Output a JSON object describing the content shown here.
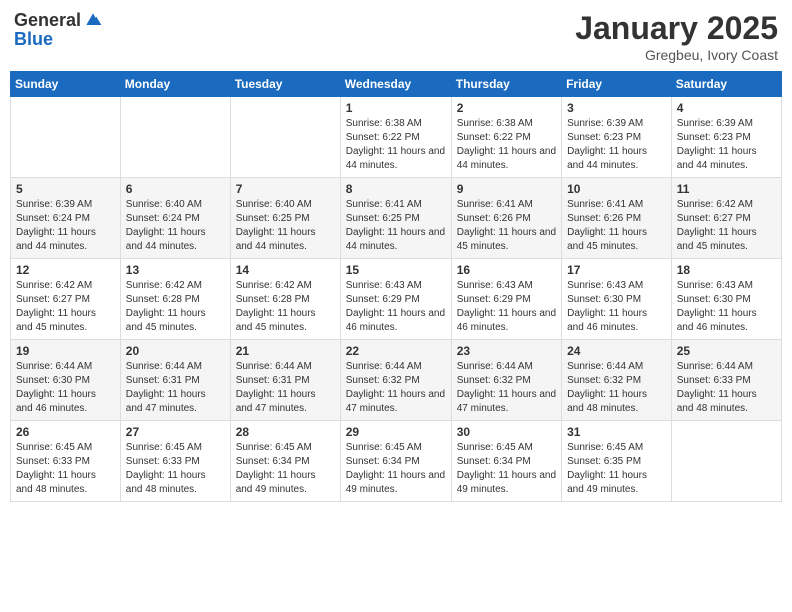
{
  "header": {
    "logo_general": "General",
    "logo_blue": "Blue",
    "title": "January 2025",
    "location": "Gregbeu, Ivory Coast"
  },
  "days_of_week": [
    "Sunday",
    "Monday",
    "Tuesday",
    "Wednesday",
    "Thursday",
    "Friday",
    "Saturday"
  ],
  "weeks": [
    [
      {
        "day": "",
        "info": ""
      },
      {
        "day": "",
        "info": ""
      },
      {
        "day": "",
        "info": ""
      },
      {
        "day": "1",
        "info": "Sunrise: 6:38 AM\nSunset: 6:22 PM\nDaylight: 11 hours and 44 minutes."
      },
      {
        "day": "2",
        "info": "Sunrise: 6:38 AM\nSunset: 6:22 PM\nDaylight: 11 hours and 44 minutes."
      },
      {
        "day": "3",
        "info": "Sunrise: 6:39 AM\nSunset: 6:23 PM\nDaylight: 11 hours and 44 minutes."
      },
      {
        "day": "4",
        "info": "Sunrise: 6:39 AM\nSunset: 6:23 PM\nDaylight: 11 hours and 44 minutes."
      }
    ],
    [
      {
        "day": "5",
        "info": "Sunrise: 6:39 AM\nSunset: 6:24 PM\nDaylight: 11 hours and 44 minutes."
      },
      {
        "day": "6",
        "info": "Sunrise: 6:40 AM\nSunset: 6:24 PM\nDaylight: 11 hours and 44 minutes."
      },
      {
        "day": "7",
        "info": "Sunrise: 6:40 AM\nSunset: 6:25 PM\nDaylight: 11 hours and 44 minutes."
      },
      {
        "day": "8",
        "info": "Sunrise: 6:41 AM\nSunset: 6:25 PM\nDaylight: 11 hours and 44 minutes."
      },
      {
        "day": "9",
        "info": "Sunrise: 6:41 AM\nSunset: 6:26 PM\nDaylight: 11 hours and 45 minutes."
      },
      {
        "day": "10",
        "info": "Sunrise: 6:41 AM\nSunset: 6:26 PM\nDaylight: 11 hours and 45 minutes."
      },
      {
        "day": "11",
        "info": "Sunrise: 6:42 AM\nSunset: 6:27 PM\nDaylight: 11 hours and 45 minutes."
      }
    ],
    [
      {
        "day": "12",
        "info": "Sunrise: 6:42 AM\nSunset: 6:27 PM\nDaylight: 11 hours and 45 minutes."
      },
      {
        "day": "13",
        "info": "Sunrise: 6:42 AM\nSunset: 6:28 PM\nDaylight: 11 hours and 45 minutes."
      },
      {
        "day": "14",
        "info": "Sunrise: 6:42 AM\nSunset: 6:28 PM\nDaylight: 11 hours and 45 minutes."
      },
      {
        "day": "15",
        "info": "Sunrise: 6:43 AM\nSunset: 6:29 PM\nDaylight: 11 hours and 46 minutes."
      },
      {
        "day": "16",
        "info": "Sunrise: 6:43 AM\nSunset: 6:29 PM\nDaylight: 11 hours and 46 minutes."
      },
      {
        "day": "17",
        "info": "Sunrise: 6:43 AM\nSunset: 6:30 PM\nDaylight: 11 hours and 46 minutes."
      },
      {
        "day": "18",
        "info": "Sunrise: 6:43 AM\nSunset: 6:30 PM\nDaylight: 11 hours and 46 minutes."
      }
    ],
    [
      {
        "day": "19",
        "info": "Sunrise: 6:44 AM\nSunset: 6:30 PM\nDaylight: 11 hours and 46 minutes."
      },
      {
        "day": "20",
        "info": "Sunrise: 6:44 AM\nSunset: 6:31 PM\nDaylight: 11 hours and 47 minutes."
      },
      {
        "day": "21",
        "info": "Sunrise: 6:44 AM\nSunset: 6:31 PM\nDaylight: 11 hours and 47 minutes."
      },
      {
        "day": "22",
        "info": "Sunrise: 6:44 AM\nSunset: 6:32 PM\nDaylight: 11 hours and 47 minutes."
      },
      {
        "day": "23",
        "info": "Sunrise: 6:44 AM\nSunset: 6:32 PM\nDaylight: 11 hours and 47 minutes."
      },
      {
        "day": "24",
        "info": "Sunrise: 6:44 AM\nSunset: 6:32 PM\nDaylight: 11 hours and 48 minutes."
      },
      {
        "day": "25",
        "info": "Sunrise: 6:44 AM\nSunset: 6:33 PM\nDaylight: 11 hours and 48 minutes."
      }
    ],
    [
      {
        "day": "26",
        "info": "Sunrise: 6:45 AM\nSunset: 6:33 PM\nDaylight: 11 hours and 48 minutes."
      },
      {
        "day": "27",
        "info": "Sunrise: 6:45 AM\nSunset: 6:33 PM\nDaylight: 11 hours and 48 minutes."
      },
      {
        "day": "28",
        "info": "Sunrise: 6:45 AM\nSunset: 6:34 PM\nDaylight: 11 hours and 49 minutes."
      },
      {
        "day": "29",
        "info": "Sunrise: 6:45 AM\nSunset: 6:34 PM\nDaylight: 11 hours and 49 minutes."
      },
      {
        "day": "30",
        "info": "Sunrise: 6:45 AM\nSunset: 6:34 PM\nDaylight: 11 hours and 49 minutes."
      },
      {
        "day": "31",
        "info": "Sunrise: 6:45 AM\nSunset: 6:35 PM\nDaylight: 11 hours and 49 minutes."
      },
      {
        "day": "",
        "info": ""
      }
    ]
  ]
}
